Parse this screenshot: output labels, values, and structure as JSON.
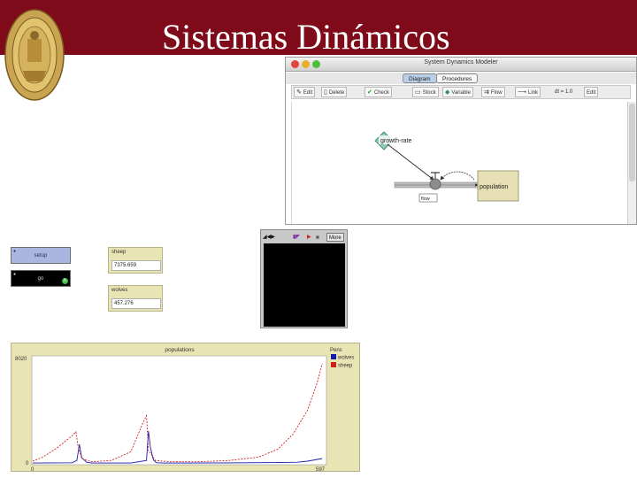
{
  "slide": {
    "title": "Sistemas Dinámicos"
  },
  "sdm": {
    "window_title": "System Dynamics Modeler",
    "tabs": [
      {
        "label": "Diagram"
      },
      {
        "label": "Procedures"
      }
    ],
    "toolbar": {
      "edit": "Edit",
      "delete": "Delete",
      "check": "Check",
      "stock": "Stock",
      "variable": "Variable",
      "flow": "Flow",
      "link": "Link",
      "dt": "dt = 1.0",
      "edit_dt": "Edit"
    },
    "diagram": {
      "variable": "growth-rate",
      "stock": "population",
      "flow": "flow"
    }
  },
  "widgets": {
    "setup_button": "setup",
    "go_button": "go",
    "sheep": {
      "label": "sheep",
      "value": "7375.659"
    },
    "wolves": {
      "label": "wolves",
      "value": "457.276"
    },
    "view_more": "More"
  },
  "chart_data": {
    "type": "line",
    "title": "populations",
    "xlabel": "",
    "ylabel": "",
    "xlim": [
      0,
      597
    ],
    "ylim": [
      0,
      8020
    ],
    "x_ticks": [
      "0",
      "597"
    ],
    "y_ticks": [
      "0",
      "8020"
    ],
    "legend_title": "Pens",
    "legend_position": "right",
    "colors": {
      "wolves": "#1a1aa8",
      "sheep": "#cc1f1f"
    },
    "series": [
      {
        "name": "wolves",
        "style": "solid",
        "x": [
          0,
          80,
          90,
          95,
          100,
          110,
          120,
          200,
          232,
          236,
          240,
          246,
          252,
          270,
          320,
          400,
          500,
          540,
          560,
          590
        ],
        "y": [
          60,
          80,
          250,
          1450,
          450,
          120,
          60,
          60,
          250,
          2450,
          1200,
          300,
          80,
          60,
          60,
          70,
          90,
          120,
          200,
          400
        ]
      },
      {
        "name": "sheep",
        "style": "dashed",
        "x": [
          0,
          20,
          50,
          80,
          88,
          92,
          100,
          120,
          160,
          200,
          225,
          232,
          236,
          250,
          280,
          340,
          400,
          460,
          500,
          530,
          560,
          580,
          590
        ],
        "y": [
          200,
          500,
          1200,
          2100,
          2400,
          1400,
          400,
          150,
          250,
          900,
          3100,
          3600,
          1000,
          250,
          150,
          150,
          250,
          500,
          1100,
          2200,
          4000,
          6100,
          7500
        ]
      }
    ]
  }
}
